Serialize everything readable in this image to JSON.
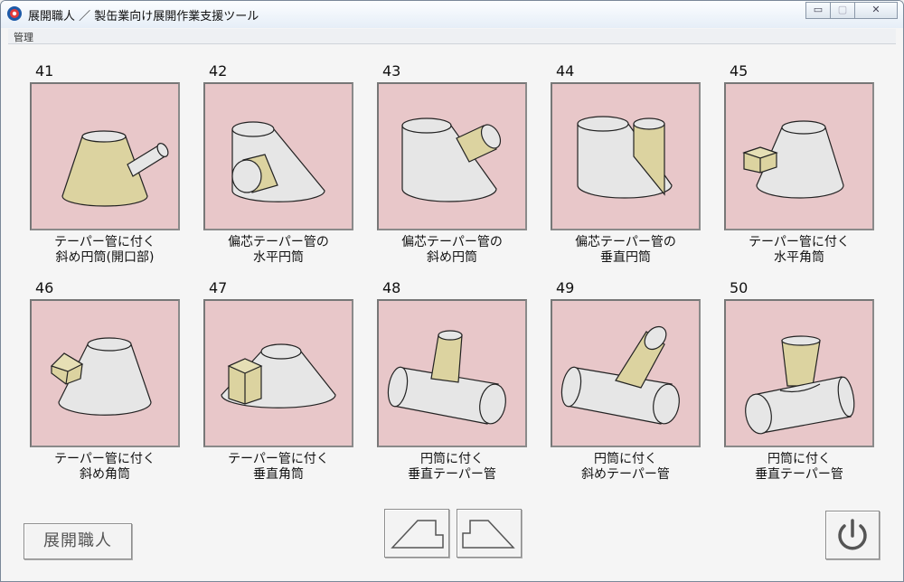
{
  "window": {
    "title": "展開職人 ／ 製缶業向け展開作業支援ツール"
  },
  "window_controls": {
    "minimize": "▭",
    "maximize": "▢",
    "close": "✕"
  },
  "menu": {
    "items": [
      "管理"
    ]
  },
  "tiles": [
    {
      "number": "41",
      "line1": "テーパー管に付く",
      "line2": "斜め円筒(開口部)"
    },
    {
      "number": "42",
      "line1": "偏芯テーパー管の",
      "line2": "水平円筒"
    },
    {
      "number": "43",
      "line1": "偏芯テーパー管の",
      "line2": "斜め円筒"
    },
    {
      "number": "44",
      "line1": "偏芯テーパー管の",
      "line2": "垂直円筒"
    },
    {
      "number": "45",
      "line1": "テーパー管に付く",
      "line2": "水平角筒"
    },
    {
      "number": "46",
      "line1": "テーパー管に付く",
      "line2": "斜め角筒"
    },
    {
      "number": "47",
      "line1": "テーパー管に付く",
      "line2": "垂直角筒"
    },
    {
      "number": "48",
      "line1": "円筒に付く",
      "line2": "垂直テーパー管"
    },
    {
      "number": "49",
      "line1": "円筒に付く",
      "line2": "斜めテーパー管"
    },
    {
      "number": "50",
      "line1": "円筒に付く",
      "line2": "垂直テーパー管"
    }
  ],
  "footer": {
    "brand_button": "展開職人"
  },
  "colors": {
    "tile_bg": "#e8c7c9",
    "accent_shape": "#dcd3a0",
    "body_shape": "#e6e6e6"
  }
}
